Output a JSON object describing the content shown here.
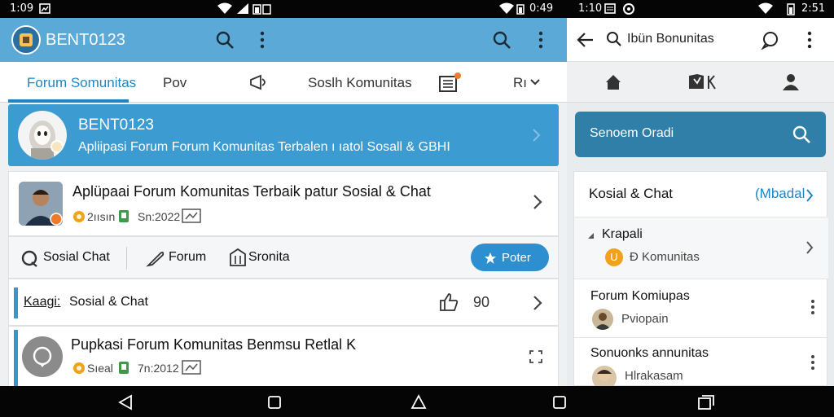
{
  "status_bar": {
    "left_time": "1:09",
    "left_pane_right": "0:49",
    "right_pane_left": "1:10",
    "right_pane_right": "2:51"
  },
  "left": {
    "app_title": "BENT0123",
    "tabs": [
      {
        "label": "Forum Somunitas"
      },
      {
        "label": "Pov"
      },
      {
        "label": "Soslh Komunitas"
      },
      {
        "label": "Rı"
      }
    ],
    "tab_badge_color": "#f07a2a",
    "banner": {
      "name": "BENT0123",
      "subtitle": "Apliipasi Forum Forum Komunitas Terbalen ı ıatol Sosall & GBHI"
    },
    "post1": {
      "title": "Aplüpaai  Forum Komunitas Terbaik patur Sosial & Chat",
      "meta_user": "2ıısın",
      "meta_date": "Sn:2022"
    },
    "actions": {
      "chat": "Sosial Chat",
      "forum": "Forum",
      "stats": "Sronita",
      "post_button": "Poter"
    },
    "category": {
      "label": "Kaagi:",
      "value": "Sosial & Chat",
      "count": "90"
    },
    "post2": {
      "title": "Pupkasi Forum Komunitas Benmsu Retlal K",
      "meta_user": "Sıeal",
      "meta_date": "7n:2012"
    }
  },
  "right": {
    "search_title": "Ibün Bonunitas",
    "search_placeholder": "Senoem Oradi",
    "section_title": "Kosial & Chat",
    "section_link": "(Mbadal",
    "rows": [
      {
        "title": "Krapali",
        "sub": "Ð Komunitas",
        "badge": "U"
      },
      {
        "title": "Forum Komiupas",
        "sub": "Pviopain"
      },
      {
        "title": "Sonuonks annunitas",
        "sub": "Hlrakasam"
      }
    ]
  },
  "colors": {
    "accent": "#1e86c4",
    "appbar": "#5aa9d6",
    "banner": "#3c9bd0",
    "right_search": "#2f7fa8",
    "left_marker": "#3796cc",
    "badge_orange": "#f0a21a"
  }
}
